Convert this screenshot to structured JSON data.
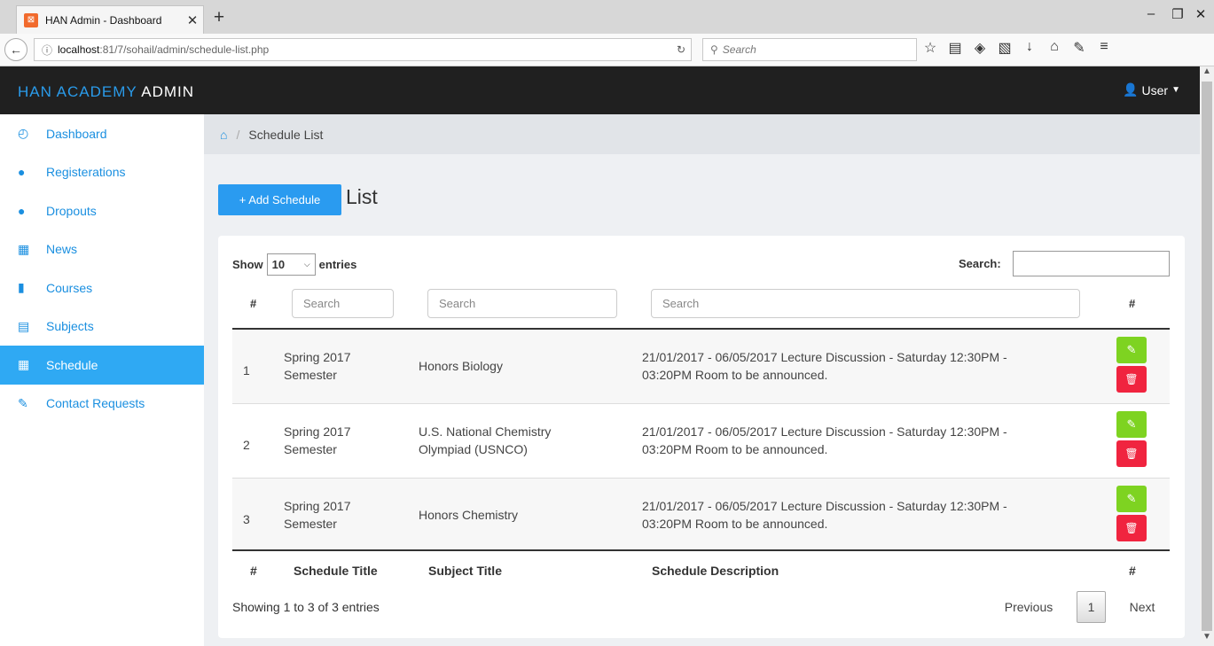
{
  "browser": {
    "tab_title": "HAN Admin - Dashboard",
    "tab_close": "✕",
    "new_tab": "+",
    "url_host": "localhost",
    "url_path": ":81/7/sohail/admin/schedule-list.php",
    "search_placeholder": "Search",
    "win_minimize": "–",
    "win_restore": "❐",
    "win_close": "✕"
  },
  "topbar": {
    "brand_prefix": "HAN ACADEMY ",
    "brand_suffix": "ADMIN",
    "user_label": "User"
  },
  "sidebar": {
    "items": [
      {
        "label": "Dashboard",
        "icon": "dashboard-icon"
      },
      {
        "label": "Registerations",
        "icon": "user-icon"
      },
      {
        "label": "Dropouts",
        "icon": "user-icon"
      },
      {
        "label": "News",
        "icon": "grid-icon"
      },
      {
        "label": "Courses",
        "icon": "bar-chart-icon"
      },
      {
        "label": "Subjects",
        "icon": "list-icon"
      },
      {
        "label": "Schedule",
        "icon": "grid-icon",
        "active": true
      },
      {
        "label": "Contact Requests",
        "icon": "pencil-icon"
      }
    ]
  },
  "breadcrumb": {
    "current": "Schedule List"
  },
  "page": {
    "add_button": "+ Add Schedule",
    "heading": "List"
  },
  "table": {
    "show_label": "Show",
    "page_length": "10",
    "entries_label": "entries",
    "search_label": "Search:",
    "filter_placeholders": [
      "Search",
      "Search",
      "Search"
    ],
    "hash": "#",
    "footer_headers": [
      "#",
      "Schedule Title",
      "Subject Title",
      "Schedule Description",
      "#"
    ],
    "rows": [
      {
        "num": "1",
        "title_line1": "Spring 2017",
        "title_line2": "Semester",
        "subject_line1": "Honors Biology",
        "subject_line2": "",
        "desc_line1": "21/01/2017 - 06/05/2017 Lecture Discussion - Saturday 12:30PM -",
        "desc_line2": "03:20PM Room to be announced."
      },
      {
        "num": "2",
        "title_line1": "Spring 2017",
        "title_line2": "Semester",
        "subject_line1": "U.S. National Chemistry",
        "subject_line2": "Olympiad (USNCO)",
        "desc_line1": "21/01/2017 - 06/05/2017 Lecture Discussion - Saturday 12:30PM -",
        "desc_line2": "03:20PM Room to be announced."
      },
      {
        "num": "3",
        "title_line1": "Spring 2017",
        "title_line2": "Semester",
        "subject_line1": "Honors Chemistry",
        "subject_line2": "",
        "desc_line1": "21/01/2017 - 06/05/2017 Lecture Discussion - Saturday 12:30PM -",
        "desc_line2": "03:20PM Room to be announced."
      }
    ],
    "info": "Showing 1 to 3 of 3 entries",
    "pagination": {
      "previous": "Previous",
      "current": "1",
      "next": "Next"
    }
  },
  "colors": {
    "accent": "#2a9bf0",
    "edit": "#7ed321",
    "delete": "#f0243f",
    "topbar": "#202020"
  }
}
